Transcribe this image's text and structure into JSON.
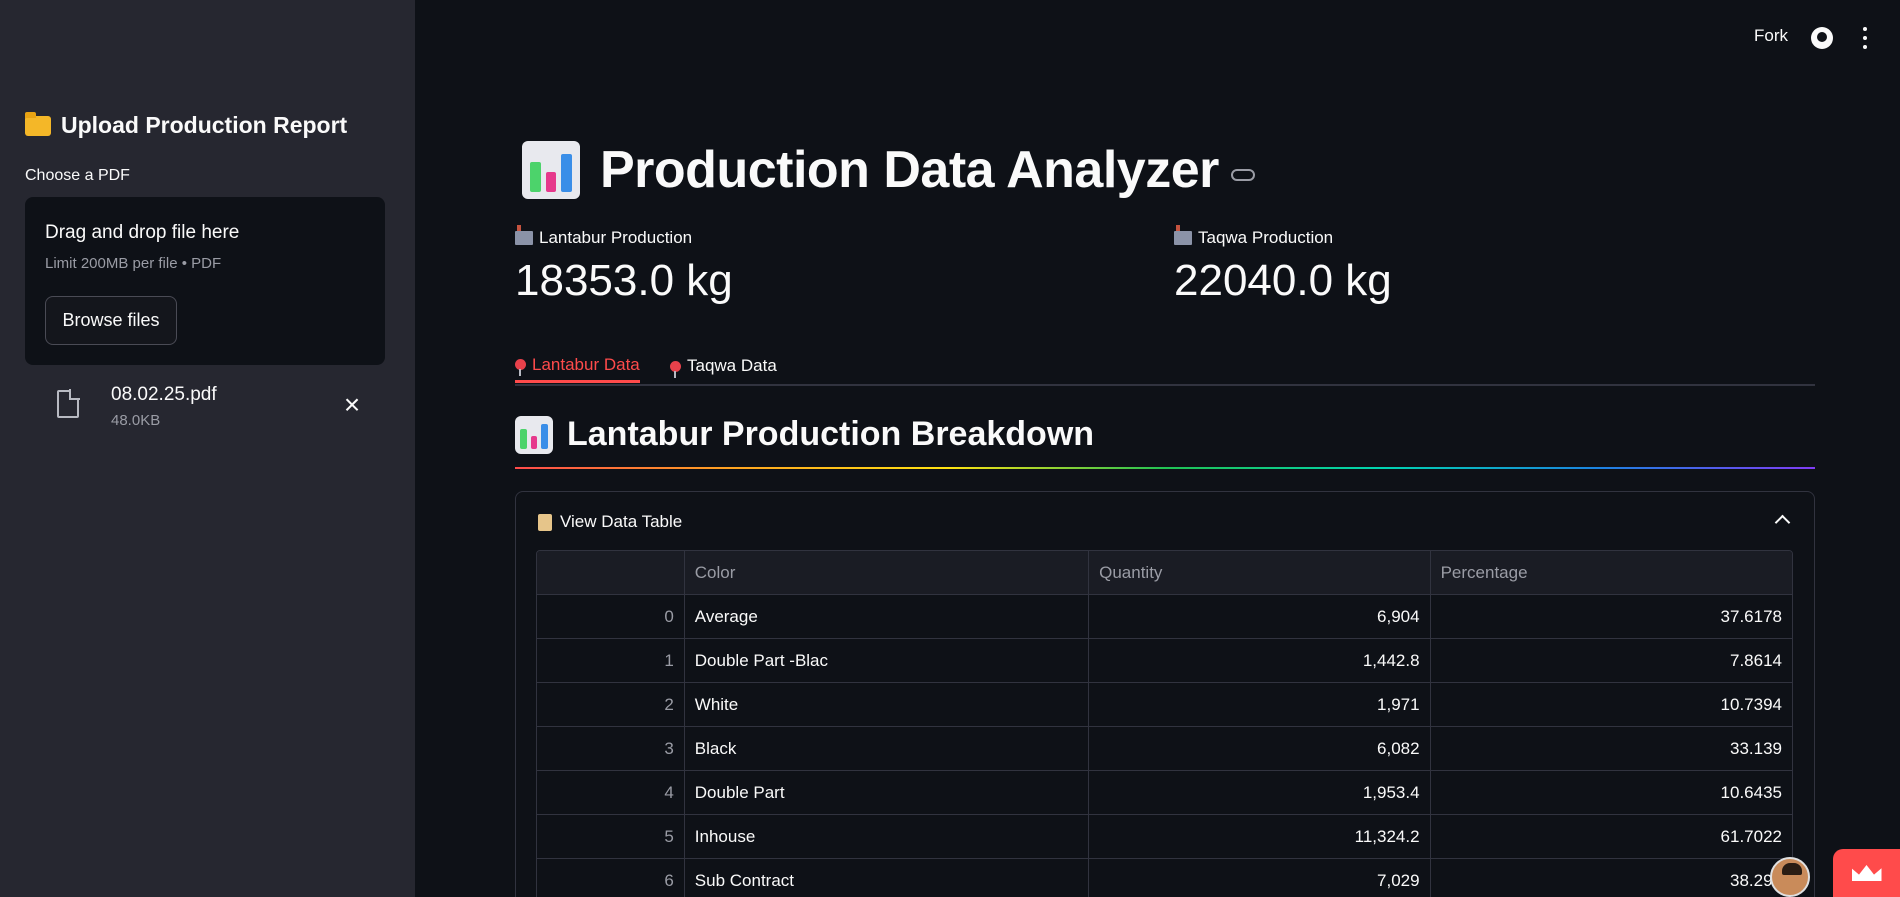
{
  "header": {
    "fork_label": "Fork"
  },
  "sidebar": {
    "title": "Upload Production Report",
    "uploader_label": "Choose a PDF",
    "dropzone_title": "Drag and drop file here",
    "dropzone_limit": "Limit 200MB per file • PDF",
    "browse_label": "Browse files",
    "file": {
      "name": "08.02.25.pdf",
      "size": "48.0KB"
    }
  },
  "main": {
    "title": "Production Data Analyzer",
    "metrics": [
      {
        "label": "Lantabur Production",
        "value": "18353.0 kg"
      },
      {
        "label": "Taqwa Production",
        "value": "22040.0 kg"
      }
    ],
    "tabs": [
      {
        "label": "Lantabur Data",
        "active": true
      },
      {
        "label": "Taqwa Data",
        "active": false
      }
    ],
    "section_title": "Lantabur Production Breakdown",
    "expander_label": "View Data Table",
    "table": {
      "columns": [
        "",
        "Color",
        "Quantity",
        "Percentage"
      ],
      "rows": [
        [
          "0",
          "Average",
          "6,904",
          "37.6178"
        ],
        [
          "1",
          "Double Part -Blac",
          "1,442.8",
          "7.8614"
        ],
        [
          "2",
          "White",
          "1,971",
          "10.7394"
        ],
        [
          "3",
          "Black",
          "6,082",
          "33.139"
        ],
        [
          "4",
          "Double Part",
          "1,953.4",
          "10.6435"
        ],
        [
          "5",
          "Inhouse",
          "11,324.2",
          "61.7022"
        ],
        [
          "6",
          "Sub Contract",
          "7,029",
          "38.298"
        ]
      ]
    }
  },
  "colors": {
    "accent": "#ff4b4b",
    "sidebar_bg": "#262730",
    "main_bg": "#0e1117"
  }
}
